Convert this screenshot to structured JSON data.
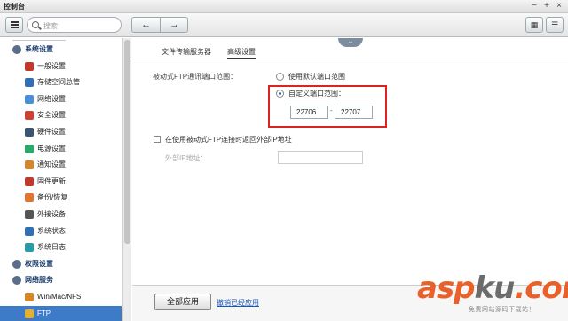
{
  "window": {
    "title": "控制台"
  },
  "toolbar": {
    "search_placeholder": "搜索"
  },
  "sidebar": {
    "items": [
      {
        "label": "系统设置",
        "icon": "gear-icon",
        "section": true,
        "color": "#5a6e8a"
      },
      {
        "label": "一般设置",
        "icon": "settings-icon",
        "section": false,
        "color": "#c0392b"
      },
      {
        "label": "存储空间总管",
        "icon": "storage-icon",
        "section": false,
        "color": "#2f6fb5"
      },
      {
        "label": "网络设置",
        "icon": "network-icon",
        "section": false,
        "color": "#4a90d9"
      },
      {
        "label": "安全设置",
        "icon": "security-icon",
        "section": false,
        "color": "#d04030"
      },
      {
        "label": "硬件设置",
        "icon": "hardware-icon",
        "section": false,
        "color": "#3b5570"
      },
      {
        "label": "电源设置",
        "icon": "power-icon",
        "section": false,
        "color": "#2da86b"
      },
      {
        "label": "通知设置",
        "icon": "notification-icon",
        "section": false,
        "color": "#d6862a"
      },
      {
        "label": "固件更新",
        "icon": "firmware-icon",
        "section": false,
        "color": "#c03a2b"
      },
      {
        "label": "备份/恢复",
        "icon": "backup-icon",
        "section": false,
        "color": "#e0752d"
      },
      {
        "label": "外接设备",
        "icon": "external-device-icon",
        "section": false,
        "color": "#555"
      },
      {
        "label": "系统状态",
        "icon": "system-status-icon",
        "section": false,
        "color": "#2f6fb5"
      },
      {
        "label": "系统日志",
        "icon": "system-log-icon",
        "section": false,
        "color": "#2a9aa8"
      },
      {
        "label": "权限设置",
        "icon": "user-icon",
        "section": true,
        "color": "#5a6e8a"
      },
      {
        "label": "网络服务",
        "icon": "network-service-icon",
        "section": true,
        "color": "#5a6e8a"
      },
      {
        "label": "Win/Mac/NFS",
        "icon": "file-sharing-icon",
        "section": false,
        "color": "#d6862a"
      },
      {
        "label": "FTP",
        "icon": "ftp-icon",
        "section": false,
        "color": "#e6b02e",
        "selected": true
      }
    ]
  },
  "tabs": [
    {
      "label": "文件传输服务器",
      "active": false
    },
    {
      "label": "高级设置",
      "active": true
    }
  ],
  "settings": {
    "passive_label": "被动式FTP通讯端口范围：",
    "option_default": "使用默认端口范围",
    "option_custom": "自定义端口范围：",
    "port_start": "22706",
    "port_separator": "-",
    "port_end": "22707",
    "return_external_ip": "在使用被动式FTP连接时返回外部IP地址",
    "external_ip_label": "外部IP地址：",
    "external_ip_value": ""
  },
  "footer": {
    "apply_all": "全部应用",
    "apply_link": "撤销已经应用"
  },
  "watermark": {
    "brand_a": "asp",
    "brand_b": "ku",
    "brand_c": ".com",
    "subtitle": "免费网站源码下载站！"
  },
  "colors": {
    "selection": "#3d7bc8",
    "highlight_box": "#dd2222",
    "link": "#1a55b0"
  }
}
